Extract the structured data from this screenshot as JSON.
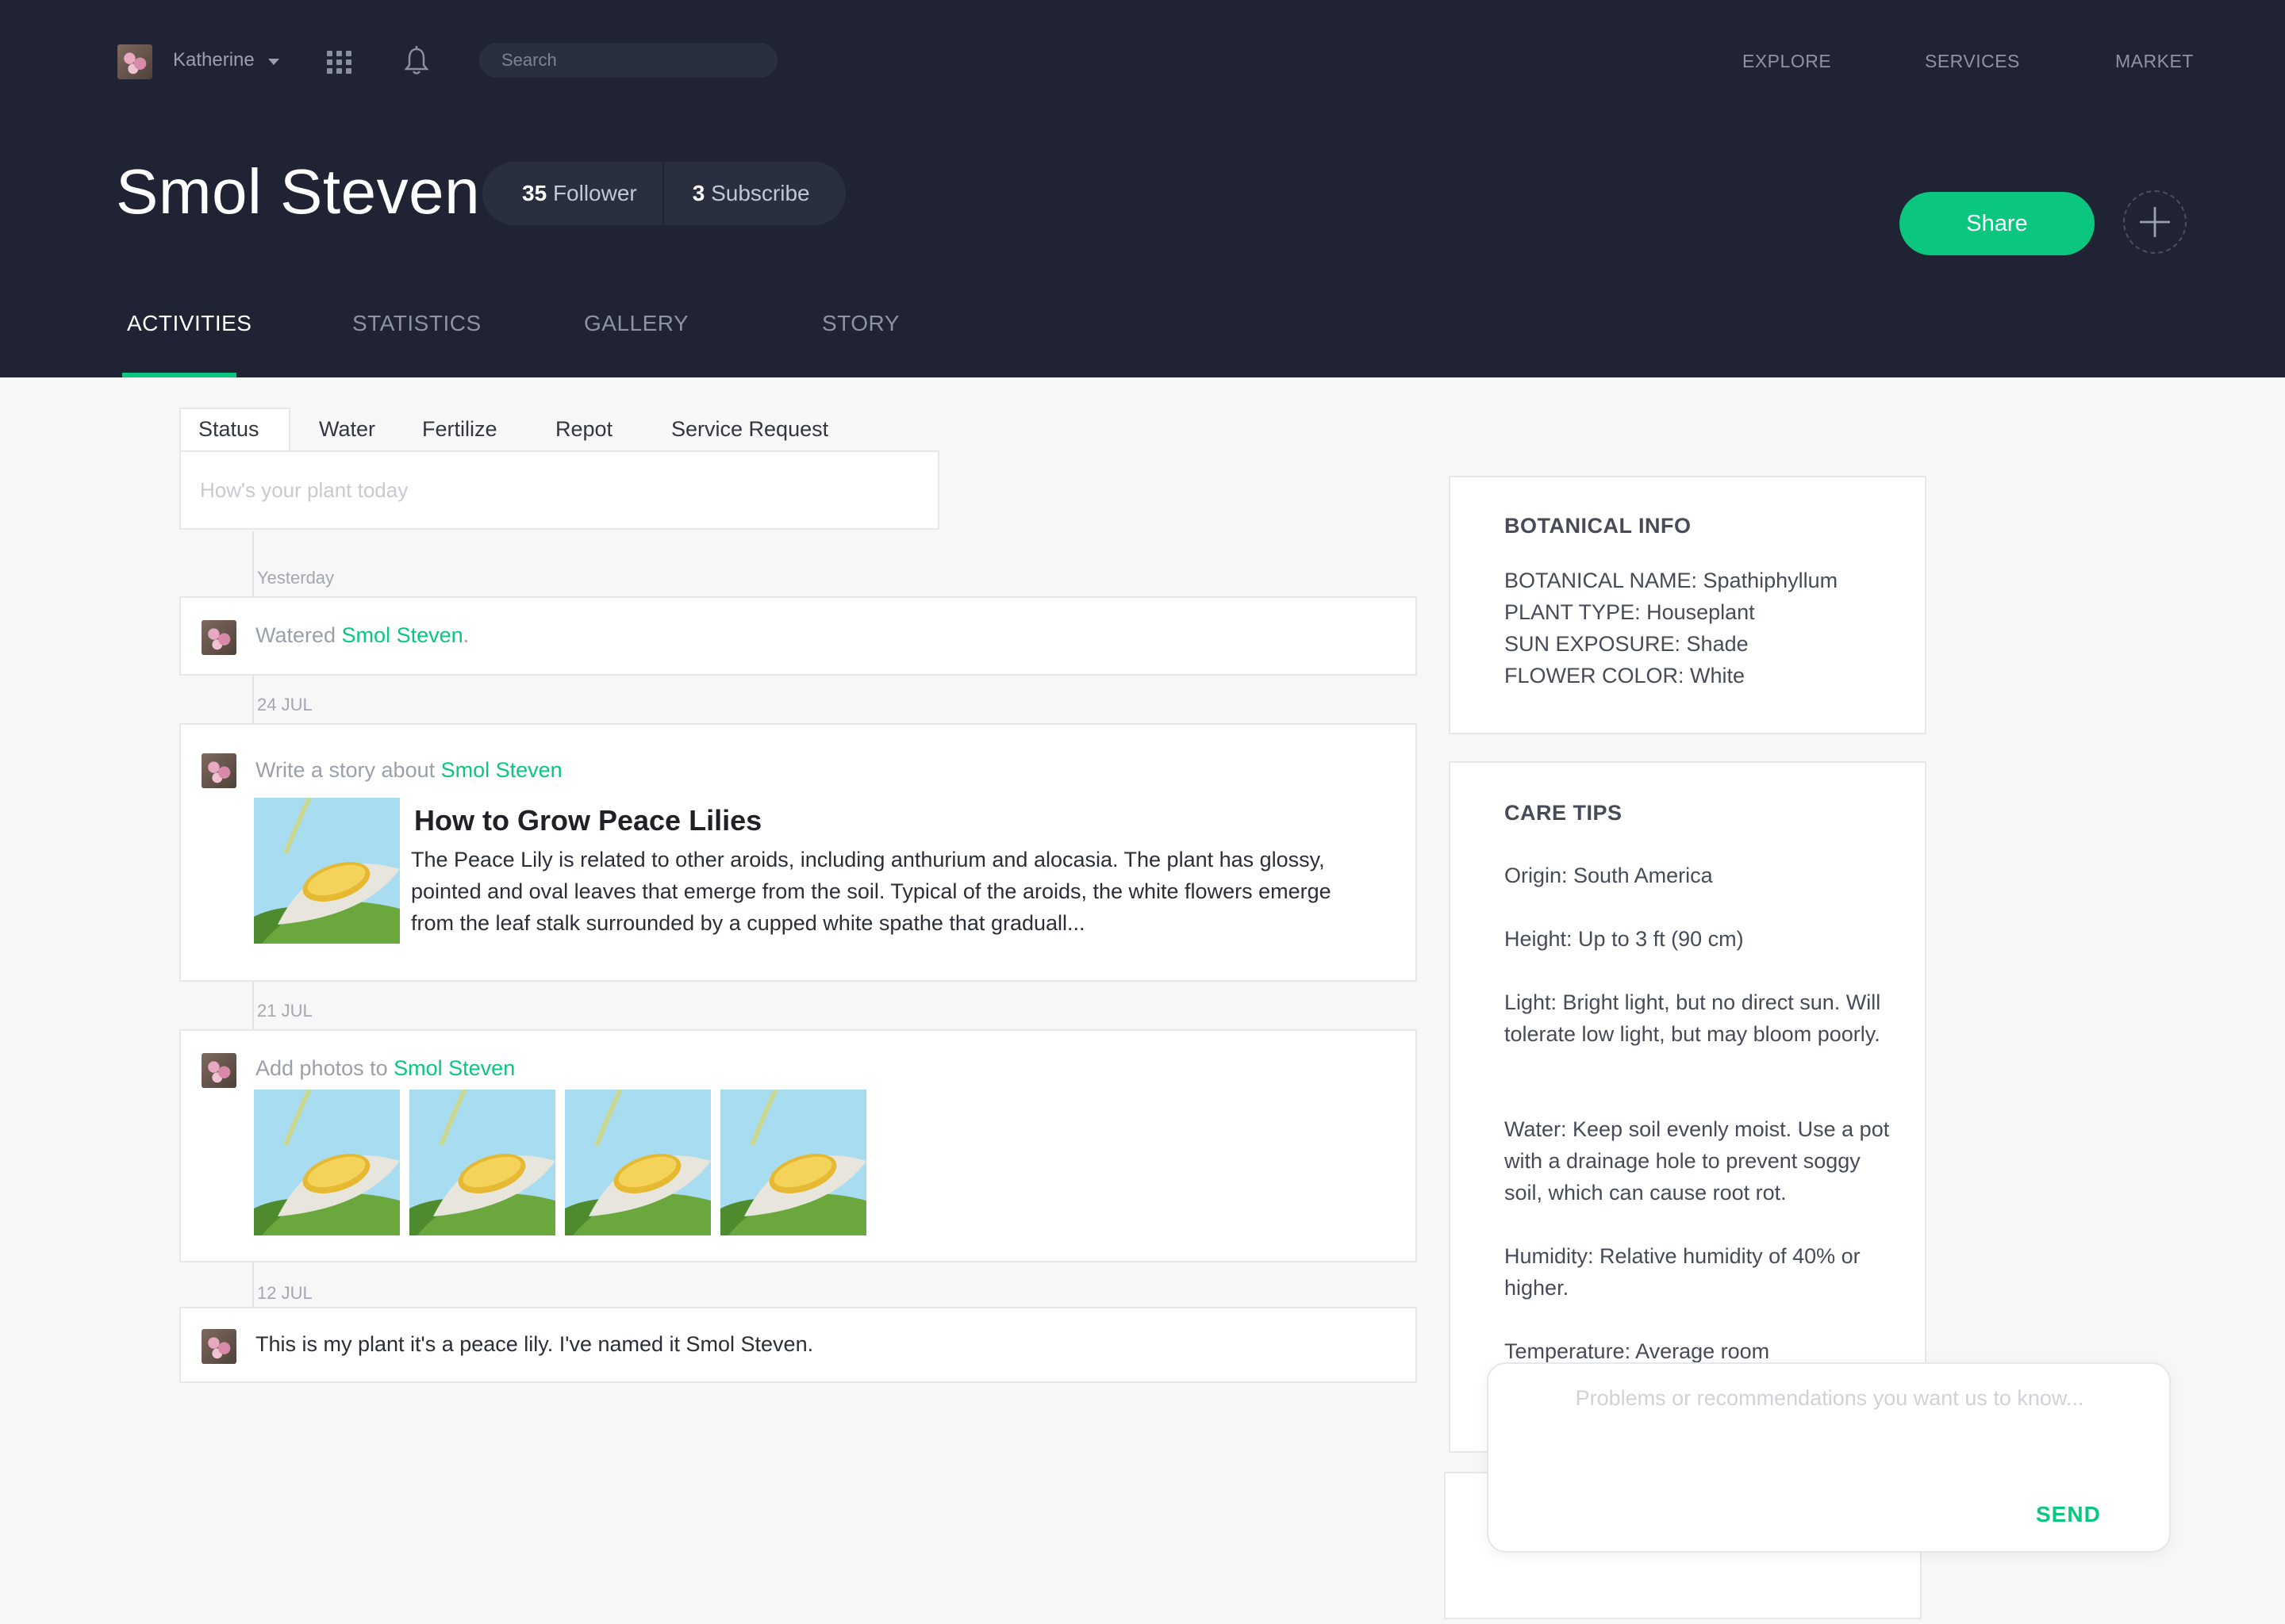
{
  "topbar": {
    "user_name": "Katherine",
    "search_placeholder": "Search",
    "nav": [
      "EXPLORE",
      "SERVICES",
      "MARKET"
    ]
  },
  "profile": {
    "name": "Smol Steven",
    "followers_count": "35",
    "followers_label": "Follower",
    "subscribe_count": "3",
    "subscribe_label": "Subscribe",
    "share_label": "Share"
  },
  "tabs": [
    "ACTIVITIES",
    "STATISTICS",
    "GALLERY",
    "STORY"
  ],
  "active_tab": "ACTIVITIES",
  "composer": {
    "tabs": [
      "Status",
      "Water",
      "Fertilize",
      "Repot",
      "Service Request"
    ],
    "active": "Status",
    "placeholder": "How's your plant today"
  },
  "timeline": [
    {
      "date": "Yesterday",
      "prefix": "Watered ",
      "link": "Smol Steven",
      "suffix": "."
    },
    {
      "date": "24 JUL",
      "prefix": "Write a story about ",
      "link": "Smol Steven",
      "story_title": "How to Grow Peace Lilies",
      "story_body": "The Peace Lily is related to other aroids, including anthurium and alocasia. The plant has glossy, pointed and oval leaves that emerge from the soil. Typical of the aroids, the white flowers emerge from the leaf stalk surrounded by a cupped white spathe that graduall..."
    },
    {
      "date": "21 JUL",
      "prefix": "Add photos to ",
      "link": "Smol Steven"
    },
    {
      "date": "12 JUL",
      "text": "This is my plant it's a peace lily. I've named it Smol Steven."
    }
  ],
  "botanical": {
    "title": "BOTANICAL INFO",
    "lines": [
      "BOTANICAL NAME: Spathiphyllum",
      "PLANT TYPE:  Houseplant",
      "SUN EXPOSURE:  Shade",
      "FLOWER COLOR:  White"
    ]
  },
  "care": {
    "title": "CARE TIPS",
    "origin": "Origin: South America",
    "height": "Height: Up to 3 ft (90 cm)",
    "light": "Light: Bright light, but no direct sun. Will tolerate low light, but may bloom poorly.",
    "water": "Water: Keep soil evenly moist. Use a pot with a drainage hole to prevent soggy soil, which can cause root rot.",
    "humidity": "Humidity: Relative humidity of 40% or higher.",
    "temperature": "Temperature: Average room"
  },
  "feedback": {
    "placeholder": "Problems or recommendations you want us to know...",
    "send_label": "SEND"
  },
  "colors": {
    "header_bg": "#1f2333",
    "accent": "#0bc67f",
    "page_bg": "#f7f7f8"
  }
}
